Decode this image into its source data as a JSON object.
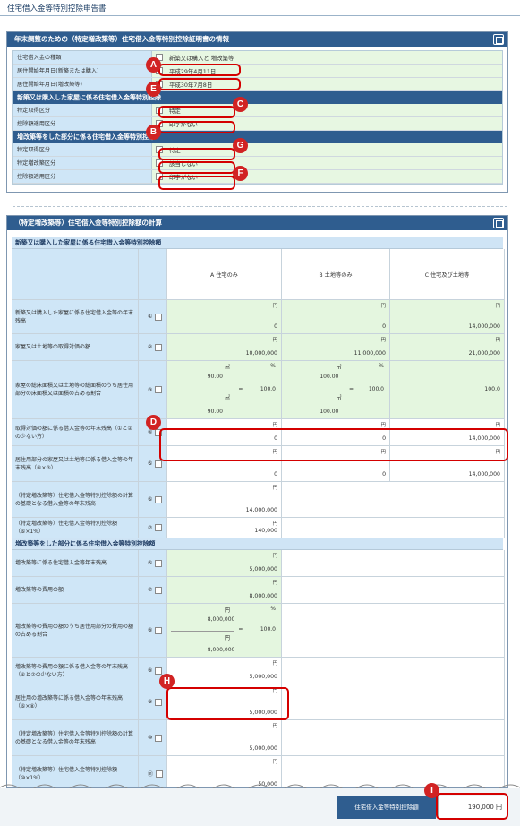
{
  "page_title": "住宅借入金等特別控除申告書",
  "panel1": {
    "title": "年末調整のための（特定増改築等）住宅借入金等特別控除証明書の情報",
    "rows": [
      {
        "label": "住宅借入金の種類",
        "value": "新築又は購入と 増改築等"
      },
      {
        "label": "居住開始年月日(新築または購入)",
        "value": "平成29年4月11日"
      },
      {
        "label": "居住開始年月日(増改築等)",
        "value": "平成30年7月8日"
      }
    ],
    "section1": {
      "title": "新築又は購入した家屋に係る住宅借入金等特別控除",
      "rows": [
        {
          "label": "特定取得区分",
          "value": "特定"
        },
        {
          "label": "控除額適用区分",
          "value": "印字がない"
        }
      ]
    },
    "section2": {
      "title": "増改築等をした部分に係る住宅借入金等特別控除",
      "rows": [
        {
          "label": "特定取得区分",
          "value": "特定"
        },
        {
          "label": "特定増改築区分",
          "value": "該当しない"
        },
        {
          "label": "控除額適用区分",
          "value": "印字がない"
        }
      ]
    }
  },
  "panel2": {
    "title": "（特定増改築等）住宅借入金等特別控除額の計算",
    "section1_title": "新築又は購入した家屋に係る住宅借入金等特別控除額",
    "col_a": "A 住宅のみ",
    "col_b": "B 土地等のみ",
    "col_c": "C 住宅及び土地等",
    "unit_yen": "円",
    "unit_m2": "㎡",
    "unit_pct": "%",
    "eq": "=",
    "rows1": [
      {
        "label": "新築又は購入した家屋に係る住宅借入金等の年末残高",
        "num": "①",
        "a": "0",
        "b": "0",
        "c": "14,000,000"
      },
      {
        "label": "家屋又は土地等の取得対価の額",
        "num": "②",
        "a": "10,000,000",
        "b": "11,000,000",
        "c": "21,000,000"
      },
      {
        "label": "家屋の総床面積又は土地等の総面積のうち居住用部分の床面積又は面積の占める割合",
        "num": "③",
        "a_top": "90.00",
        "a_bottom": "90.00",
        "a_pct": "100.0",
        "b_top": "100.00",
        "b_bottom": "100.00",
        "b_pct": "100.0",
        "c": "100.0"
      },
      {
        "label": "取得対価の額に係る借入金等の年末残高（①と②の少ない方）",
        "num": "④",
        "a": "0",
        "b": "0",
        "c": "14,000,000"
      },
      {
        "label": "居住用部分の家屋又は土地等に係る借入金等の年末残高（④×③）",
        "num": "⑤",
        "a": "0",
        "b": "0",
        "c": "14,000,000"
      },
      {
        "label": "（特定増改築等）住宅借入金等特別控除額の計算の基礎となる借入金等の年末残高",
        "num": "⑥",
        "a": "14,000,000"
      },
      {
        "label": "（特定増改築等）住宅借入金等特別控除額（⑥×1%）",
        "num": "⑦",
        "a": "140,000"
      }
    ],
    "section2_title": "増改築等をした部分に係る住宅借入金等特別控除額",
    "rows2": [
      {
        "label": "増改築等に係る住宅借入金等年末残高",
        "num": "⑤",
        "a": "5,000,000"
      },
      {
        "label": "増改築等の費用の額",
        "num": "⑦",
        "a": "8,000,000"
      },
      {
        "label": "増改築等の費用の額のうち居住用部分の費用の額の占める割合",
        "num": "⑧",
        "a_top": "8,000,000",
        "a_bottom": "8,000,000",
        "a_pct": "100.0"
      },
      {
        "label": "増改築等の費用の額に係る借入金等の年末残高（⑥と⑦の少ない方）",
        "num": "⑧",
        "a": "5,000,000"
      },
      {
        "label": "居住用の増改築等に係る借入金等の年末残高（⑥×⑧）",
        "num": "⑨",
        "a": "5,000,000"
      },
      {
        "label": "（特定増改築等）住宅借入金等特別控除額の計算の基礎となる借入金等の年末残高",
        "num": "⑩",
        "a": "5,000,000"
      },
      {
        "label": "（特定増改築等）住宅借入金等特別控除額（⑩×1%）",
        "num": "⑪",
        "a": "50,000"
      }
    ]
  },
  "footer": {
    "button": "住宅借入金等特別控除額",
    "value": "190,000 円"
  },
  "badges": {
    "a": "A",
    "b": "B",
    "c": "C",
    "d": "D",
    "e": "E",
    "f": "F",
    "g": "G",
    "h": "H",
    "i": "I"
  },
  "colors": {
    "header": "#2f5d8f",
    "label_bg": "#cfe6f7",
    "value_bg": "#e7f7e2",
    "highlight": "#d40000"
  }
}
